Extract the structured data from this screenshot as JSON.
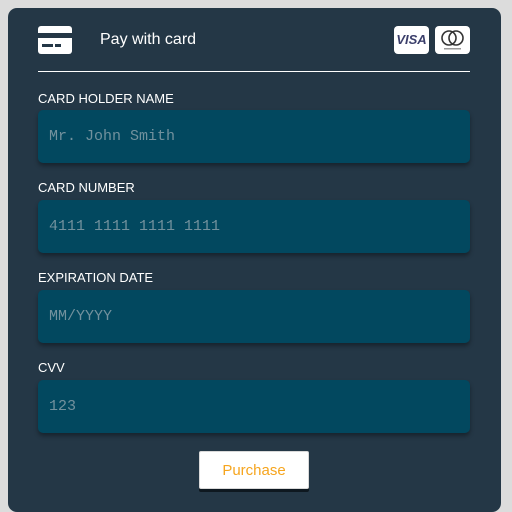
{
  "header": {
    "icon": "credit-card-icon",
    "title": "Pay with card",
    "brands": {
      "visa": "VISA",
      "mastercard_icon": "mastercard-logo"
    }
  },
  "fields": {
    "holder": {
      "label": "CARD HOLDER NAME",
      "placeholder": "Mr. John Smith",
      "value": ""
    },
    "number": {
      "label": "CARD NUMBER",
      "placeholder": "4111 1111 1111 1111",
      "value": ""
    },
    "expiry": {
      "label": "EXPIRATION DATE",
      "placeholder": "MM/YYYY",
      "value": ""
    },
    "cvv": {
      "label": "CVV",
      "placeholder": "123",
      "value": ""
    }
  },
  "actions": {
    "purchase_label": "Purchase"
  },
  "colors": {
    "panel_bg": "#243746",
    "input_bg": "#02485f",
    "accent": "#f6a51e",
    "text": "#ffffff"
  }
}
